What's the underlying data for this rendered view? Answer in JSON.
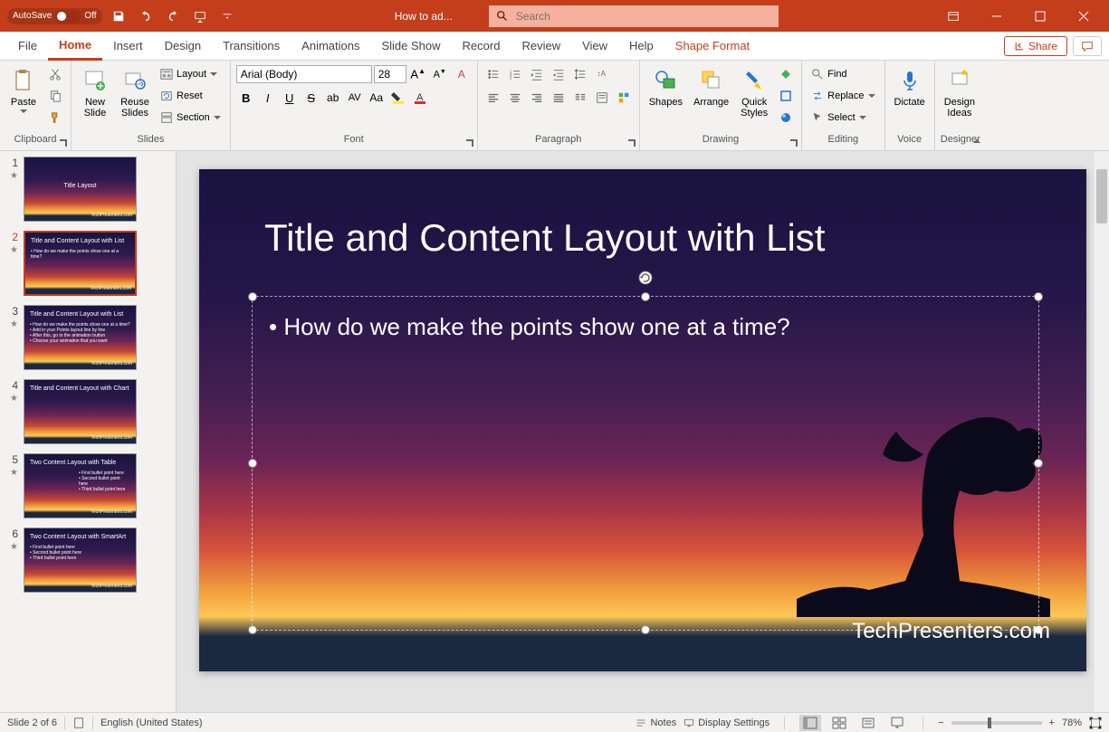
{
  "titlebar": {
    "autosave_label": "AutoSave",
    "autosave_state": "Off",
    "doc_title": "How to ad...",
    "search_placeholder": "Search"
  },
  "tabs": {
    "file": "File",
    "home": "Home",
    "insert": "Insert",
    "design": "Design",
    "transitions": "Transitions",
    "animations": "Animations",
    "slideshow": "Slide Show",
    "record": "Record",
    "review": "Review",
    "view": "View",
    "help": "Help",
    "shape_format": "Shape Format",
    "share": "Share"
  },
  "ribbon": {
    "clipboard": {
      "paste": "Paste",
      "label": "Clipboard"
    },
    "slides": {
      "new_slide": "New\nSlide",
      "reuse_slides": "Reuse\nSlides",
      "layout": "Layout",
      "reset": "Reset",
      "section": "Section",
      "label": "Slides"
    },
    "font": {
      "name": "Arial (Body)",
      "size": "28",
      "label": "Font"
    },
    "paragraph": {
      "label": "Paragraph"
    },
    "drawing": {
      "shapes": "Shapes",
      "arrange": "Arrange",
      "quick_styles": "Quick\nStyles",
      "label": "Drawing"
    },
    "editing": {
      "find": "Find",
      "replace": "Replace",
      "select": "Select",
      "label": "Editing"
    },
    "voice": {
      "dictate": "Dictate",
      "label": "Voice"
    },
    "designer": {
      "design_ideas": "Design\nIdeas",
      "label": "Designer"
    }
  },
  "thumbnails": [
    {
      "num": "1",
      "title": "Title Layout",
      "body": ""
    },
    {
      "num": "2",
      "title": "Title and Content Layout with List",
      "body": "• How do we make the points show one at a time?"
    },
    {
      "num": "3",
      "title": "Title and Content Layout with List",
      "body": "• How do we make the points show one at a time?\n• Add in your Points layout line by line\n• After this, go to the animation button\n• Choose your animation that you want"
    },
    {
      "num": "4",
      "title": "Title and Content Layout with Chart",
      "body": ""
    },
    {
      "num": "5",
      "title": "Two Content Layout with Table",
      "body": "• First bullet point here\n• Second bullet point here\n• Third bullet point here"
    },
    {
      "num": "6",
      "title": "Two Content Layout with SmartArt",
      "body": "• First bullet point here\n• Second bullet point here\n• Third bullet point here"
    }
  ],
  "slide": {
    "title": "Title and Content Layout with List",
    "bullet1": "• How do we make the points show one at a time?",
    "footer": "TechPresenters.com"
  },
  "statusbar": {
    "slide_info": "Slide 2 of 6",
    "language": "English (United States)",
    "notes": "Notes",
    "display_settings": "Display Settings",
    "zoom": "78%"
  }
}
